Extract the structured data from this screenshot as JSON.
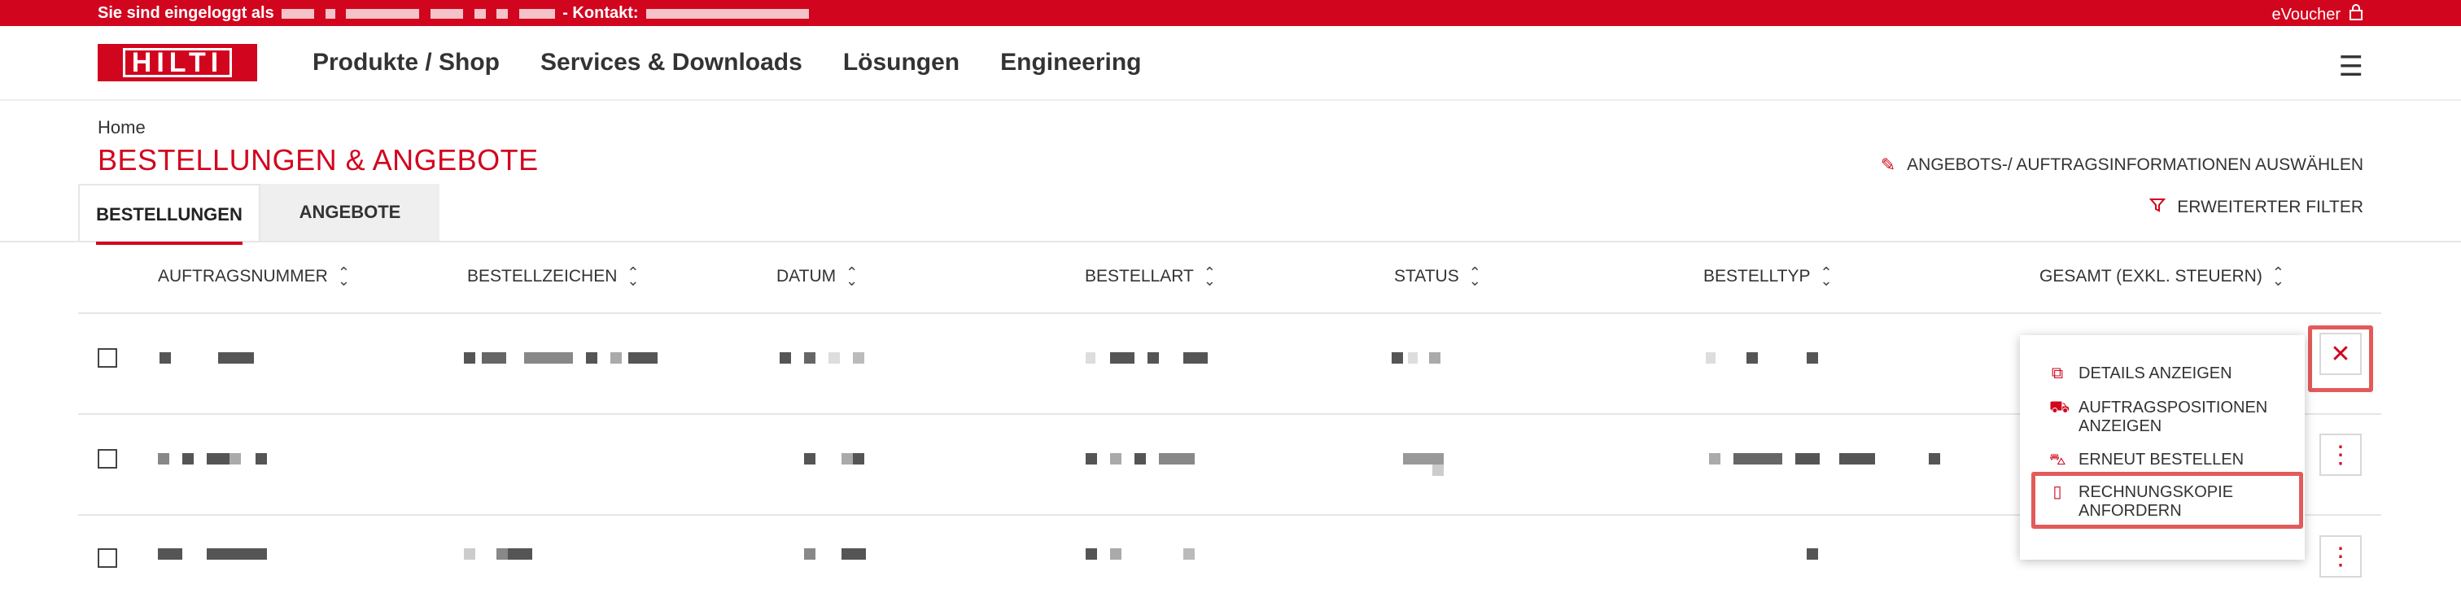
{
  "topbar": {
    "login_prefix": "Sie sind eingeloggt als",
    "contact_label": "- Kontakt:",
    "evoucher": "eVoucher",
    "lock_icon": "lock-icon"
  },
  "header": {
    "logo": "HILTI",
    "nav": [
      "Produkte / Shop",
      "Services & Downloads",
      "Lösungen",
      "Engineering"
    ],
    "menu_icon": "hamburger-icon"
  },
  "breadcrumb": "Home",
  "page_title": "BESTELLUNGEN & ANGEBOTE",
  "actions": {
    "select_info": "ANGEBOTS-/ AUFTRAGSINFORMATIONEN AUSWÄHLEN",
    "filter": "ERWEITERTER FILTER"
  },
  "tabs": [
    "BESTELLUNGEN",
    "ANGEBOTE"
  ],
  "columns": [
    "AUFTRAGSNUMMER",
    "BESTELLZEICHEN",
    "DATUM",
    "BESTELLART",
    "STATUS",
    "BESTELLTYP",
    "GESAMT (EXKL. STEUERN)"
  ],
  "row_menu": {
    "items": [
      {
        "label": "DETAILS ANZEIGEN",
        "icon": "copy-icon"
      },
      {
        "label": "AUFTRAGSPOSITIONEN ANZEIGEN",
        "icon": "hand-truck-icon"
      },
      {
        "label": "ERNEUT BESTELLEN",
        "icon": "cart-icon"
      },
      {
        "label": "RECHNUNGSKOPIE ANFORDERN",
        "icon": "document-icon"
      }
    ]
  },
  "colors": {
    "brand_red": "#d2051e",
    "highlight": "#e35a5a"
  }
}
